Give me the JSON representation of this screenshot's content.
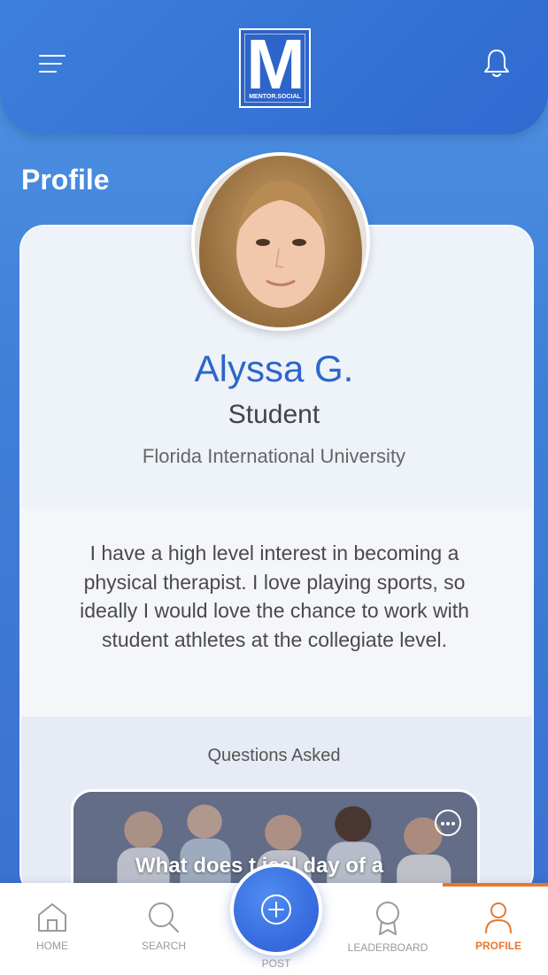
{
  "header": {
    "logo_letter": "M",
    "logo_caption": "MENTOR.SOCIAL",
    "menu_icon": "hamburger-menu-icon",
    "bell_icon": "bell-icon"
  },
  "page": {
    "title": "Profile"
  },
  "profile": {
    "name": "Alyssa G.",
    "role": "Student",
    "school": "Florida International University",
    "bio": "I have a high level interest in becoming a physical therapist. I love playing sports, so ideally I would love the chance to work with student athletes at the collegiate level."
  },
  "questions": {
    "heading": "Questions Asked",
    "items": [
      {
        "title": "What does t ical day of a"
      }
    ]
  },
  "nav": {
    "items": [
      {
        "label": "HOME",
        "icon": "home-icon"
      },
      {
        "label": "SEARCH",
        "icon": "search-icon"
      },
      {
        "label": "POST",
        "icon": "plus-circle-icon"
      },
      {
        "label": "LEADERBOARD",
        "icon": "award-icon"
      },
      {
        "label": "PROFILE",
        "icon": "user-icon"
      }
    ],
    "active": "PROFILE"
  },
  "colors": {
    "accent_blue": "#2c66c9",
    "active_orange": "#e8772e",
    "inactive_gray": "#9a9a9a"
  }
}
